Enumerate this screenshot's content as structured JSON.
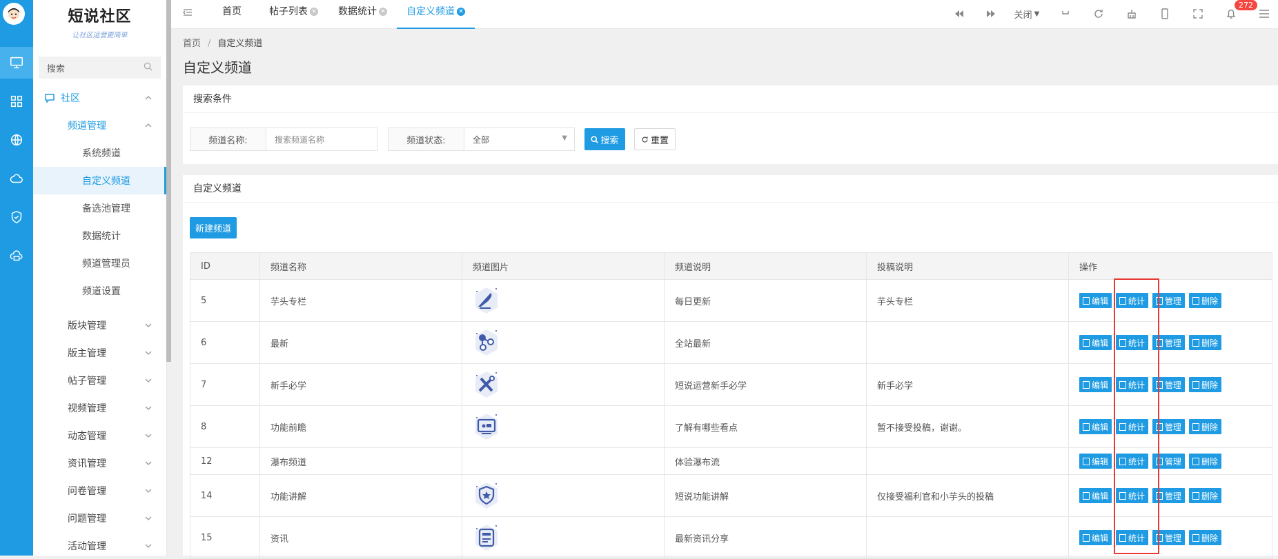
{
  "logo": {
    "title": "短说社区",
    "slogan": "让社区运营更简单"
  },
  "rail": {
    "items": [
      "monitor-icon",
      "apps-grid-icon",
      "globe-icon",
      "cloud-icon",
      "shield-check-icon",
      "cloud-server-icon"
    ]
  },
  "search": {
    "placeholder": "搜索"
  },
  "menu": {
    "community": "社区",
    "channel_mgmt": "频道管理",
    "channel_sub": [
      "系统频道",
      "自定义频道",
      "备选池管理",
      "数据统计",
      "频道管理员",
      "频道设置"
    ],
    "groups": [
      "版块管理",
      "版主管理",
      "帖子管理",
      "视频管理",
      "动态管理",
      "资讯管理",
      "问卷管理",
      "问题管理",
      "活动管理"
    ]
  },
  "tabs": [
    "首页",
    "帖子列表",
    "数据统计",
    "自定义频道"
  ],
  "topbar": {
    "close_label": "关闭",
    "badge": "272"
  },
  "breadcrumb": {
    "home": "首页",
    "current": "自定义频道"
  },
  "page_title": "自定义频道",
  "filter": {
    "title": "搜索条件",
    "name_label": "频道名称:",
    "name_placeholder": "搜索频道名称",
    "status_label": "频道状态:",
    "status_value": "全部",
    "search_btn": "搜索",
    "reset_btn": "重置"
  },
  "list": {
    "title": "自定义频道",
    "new_btn": "新建频道",
    "columns": [
      "ID",
      "频道名称",
      "频道图片",
      "频道说明",
      "投稿说明",
      "操作"
    ],
    "actions": [
      "编辑",
      "统计",
      "管理",
      "删除"
    ],
    "rows": [
      {
        "id": "5",
        "name": "芋头专栏",
        "icon": "quill-icon",
        "desc": "每日更新",
        "submit": "芋头专栏"
      },
      {
        "id": "6",
        "name": "最新",
        "icon": "molecule-icon",
        "desc": "全站最新",
        "submit": ""
      },
      {
        "id": "7",
        "name": "新手必学",
        "icon": "tools-icon",
        "desc": "短说运营新手必学",
        "submit": "新手必学"
      },
      {
        "id": "8",
        "name": "功能前瞻",
        "icon": "screen-icon",
        "desc": "了解有哪些看点",
        "submit": "暂不接受投稿，谢谢。"
      },
      {
        "id": "12",
        "name": "瀑布频道",
        "icon": "",
        "desc": "体验瀑布流",
        "submit": ""
      },
      {
        "id": "14",
        "name": "功能讲解",
        "icon": "badge-shield-icon",
        "desc": "短说功能讲解",
        "submit": "仅接受福利官和小芋头的投稿"
      },
      {
        "id": "15",
        "name": "资讯",
        "icon": "news-icon",
        "desc": "最新资讯分享",
        "submit": ""
      }
    ]
  },
  "colors": {
    "primary": "#1e9be3",
    "highlight": "#e53a35"
  }
}
